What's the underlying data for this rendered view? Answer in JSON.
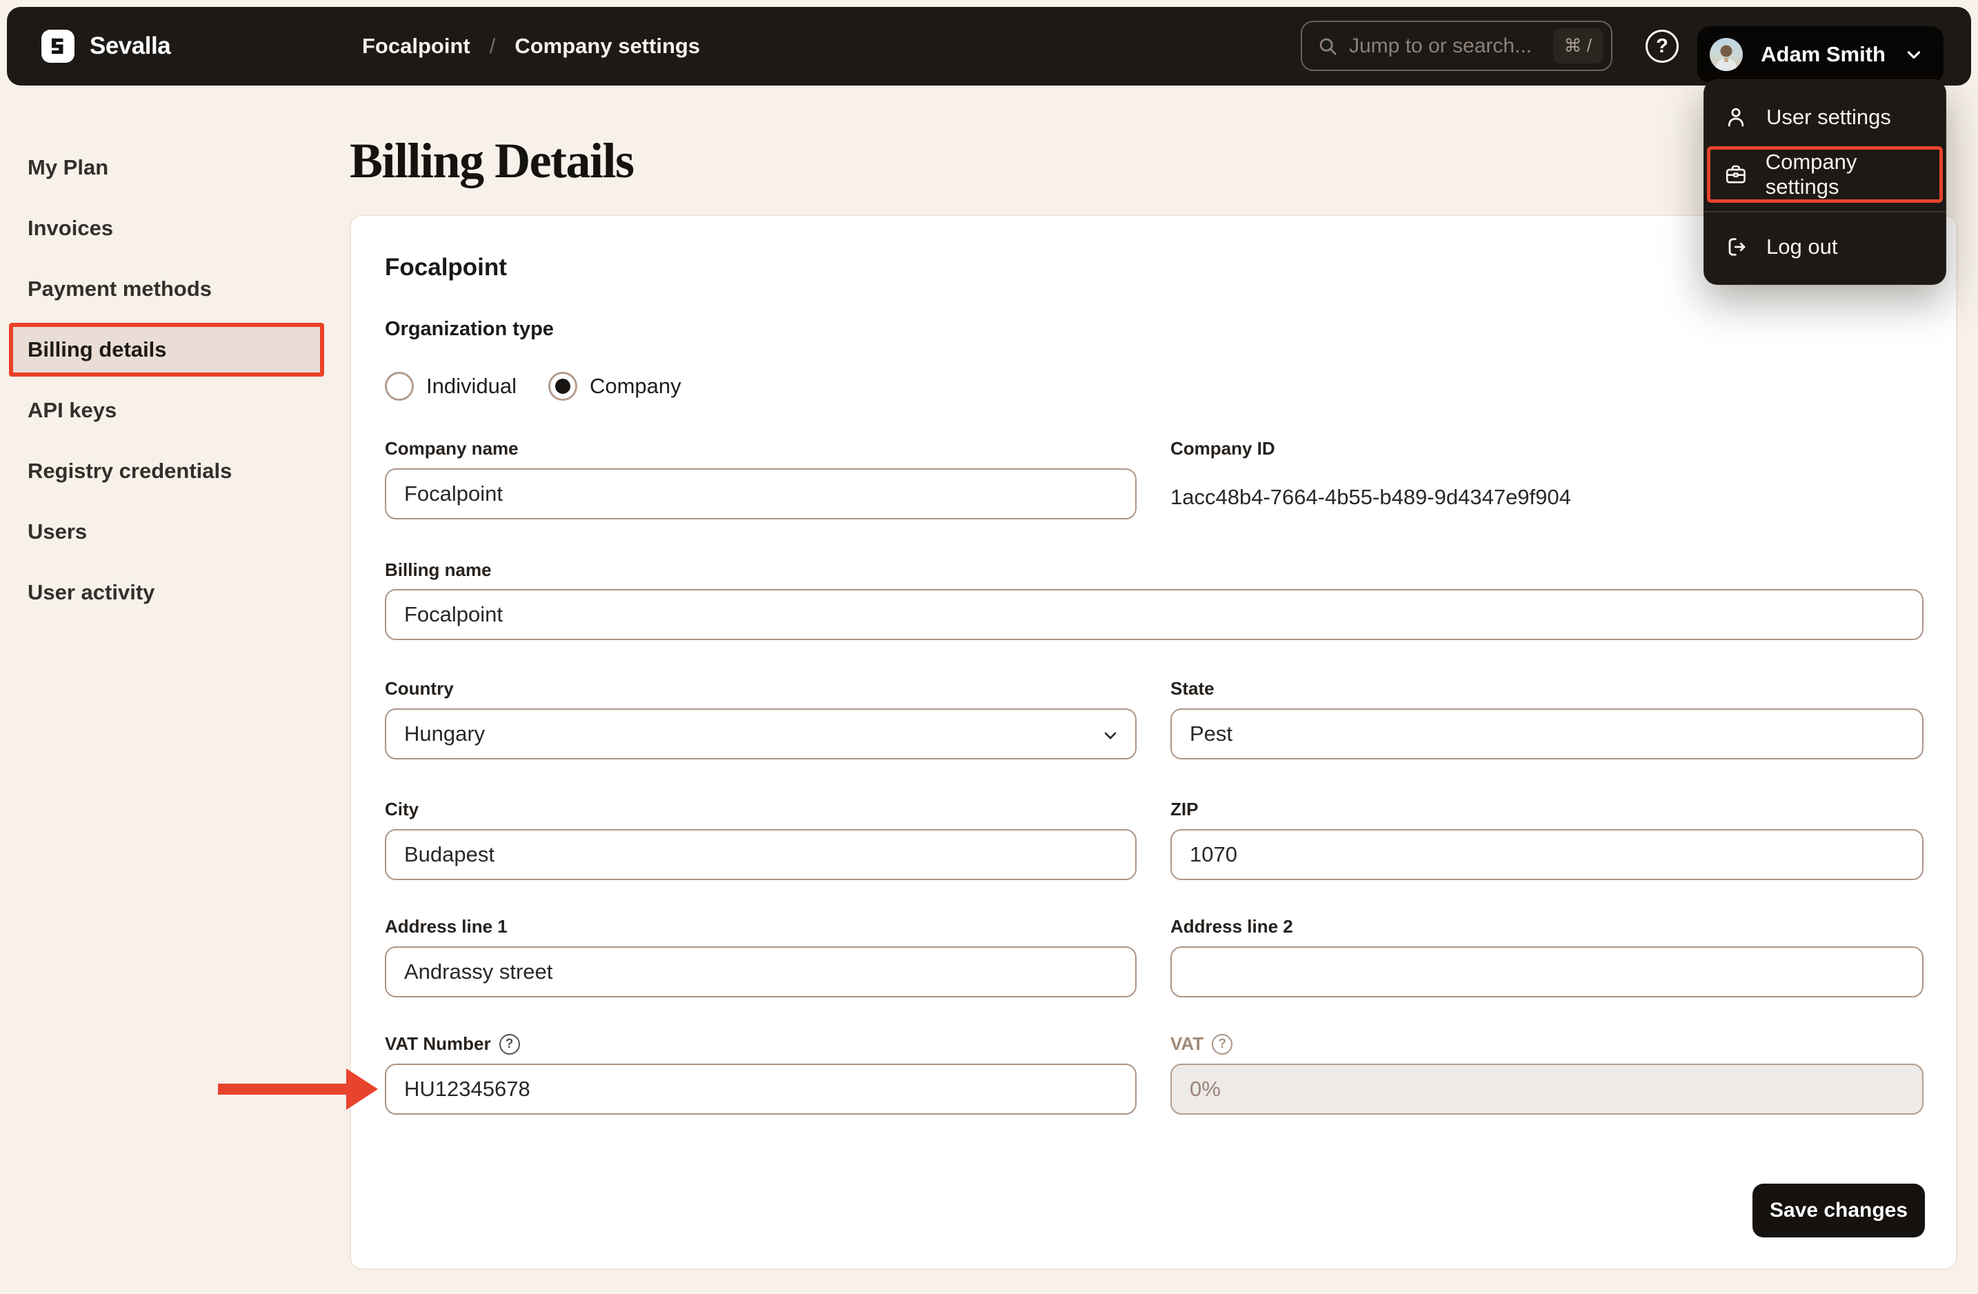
{
  "topbar": {
    "brand": "Sevalla",
    "breadcrumb": {
      "items": [
        "Focalpoint",
        "Company settings"
      ],
      "separator": "/"
    },
    "search": {
      "placeholder": "Jump to or search...",
      "shortcut": "⌘ /"
    },
    "help_glyph": "?",
    "user": {
      "name": "Adam Smith"
    }
  },
  "user_menu": {
    "items": [
      {
        "label": "User settings"
      },
      {
        "label": "Company settings",
        "highlighted": true
      },
      {
        "label": "Log out"
      }
    ]
  },
  "sidebar": {
    "items": [
      {
        "label": "My Plan"
      },
      {
        "label": "Invoices"
      },
      {
        "label": "Payment methods"
      },
      {
        "label": "Billing details",
        "active": true
      },
      {
        "label": "API keys"
      },
      {
        "label": "Registry credentials"
      },
      {
        "label": "Users"
      },
      {
        "label": "User activity"
      }
    ]
  },
  "page": {
    "title": "Billing Details"
  },
  "form": {
    "company_title": "Focalpoint",
    "organization_type": {
      "label": "Organization type",
      "options": [
        {
          "label": "Individual",
          "selected": false
        },
        {
          "label": "Company",
          "selected": true
        }
      ]
    },
    "fields": {
      "company_name": {
        "label": "Company name",
        "value": "Focalpoint"
      },
      "company_id": {
        "label": "Company ID",
        "value": "1acc48b4-7664-4b55-b489-9d4347e9f904"
      },
      "billing_name": {
        "label": "Billing name",
        "value": "Focalpoint"
      },
      "country": {
        "label": "Country",
        "value": "Hungary"
      },
      "state": {
        "label": "State",
        "value": "Pest"
      },
      "city": {
        "label": "City",
        "value": "Budapest"
      },
      "zip": {
        "label": "ZIP",
        "value": "1070"
      },
      "address1": {
        "label": "Address line 1",
        "value": "Andrassy street"
      },
      "address2": {
        "label": "Address line 2",
        "value": ""
      },
      "vat_number": {
        "label": "VAT Number",
        "value": "HU12345678"
      },
      "vat": {
        "label": "VAT",
        "value": "0%",
        "disabled": true
      }
    },
    "save_label": "Save changes"
  },
  "colors": {
    "accent_red": "#e8432c",
    "topbar_bg": "#1c1916",
    "page_bg": "#f7f1ea",
    "card_bg": "#ffffff",
    "input_border": "#ad9587",
    "active_sidebar_bg": "#e9ddd5",
    "muted_text": "#9b8578"
  }
}
